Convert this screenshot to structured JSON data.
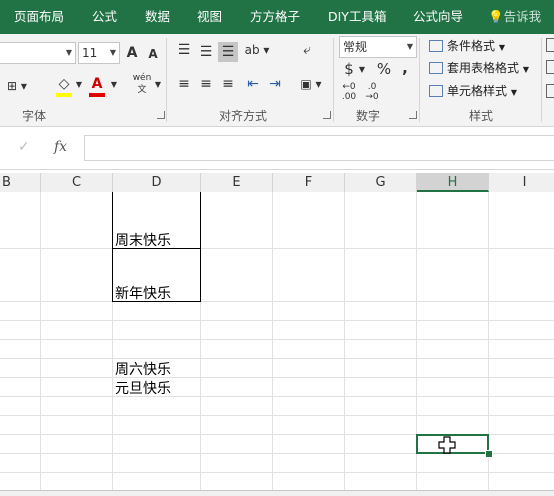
{
  "ribbon_tabs": [
    "页面布局",
    "公式",
    "数据",
    "视图",
    "方方格子",
    "DIY工具箱",
    "公式向导"
  ],
  "tell_me": "告诉我",
  "font": {
    "size": "11",
    "grow_icon": "A",
    "shrink_icon": "A",
    "fill_icon": "◇",
    "color_icon": "A",
    "phonetic_icon": "wén",
    "group_label": "字体"
  },
  "alignment": {
    "group_label": "对齐方式"
  },
  "number": {
    "format": "常规",
    "currency": "$",
    "percent": "%",
    "comma": ",",
    "increase_decimal": ".00",
    "decrease_decimal": ".0",
    "group_label": "数字"
  },
  "styles": {
    "conditional": "条件格式",
    "table": "套用表格格式",
    "cell": "单元格样式",
    "group_label": "样式"
  },
  "formula_bar": {
    "fx": "fx",
    "check": "✓",
    "value": ""
  },
  "columns": [
    "B",
    "C",
    "D",
    "E",
    "F",
    "G",
    "H",
    "I"
  ],
  "active_column": "H",
  "cells": {
    "d1": "周末快乐",
    "d2": "新年快乐",
    "d3": "周六快乐",
    "d4": "元旦快乐"
  },
  "colors": {
    "accent": "#217346",
    "ribbon_bg": "#f3f3f3",
    "font_color_bar": "#e00000",
    "fill_color_bar": "#ffff00"
  }
}
